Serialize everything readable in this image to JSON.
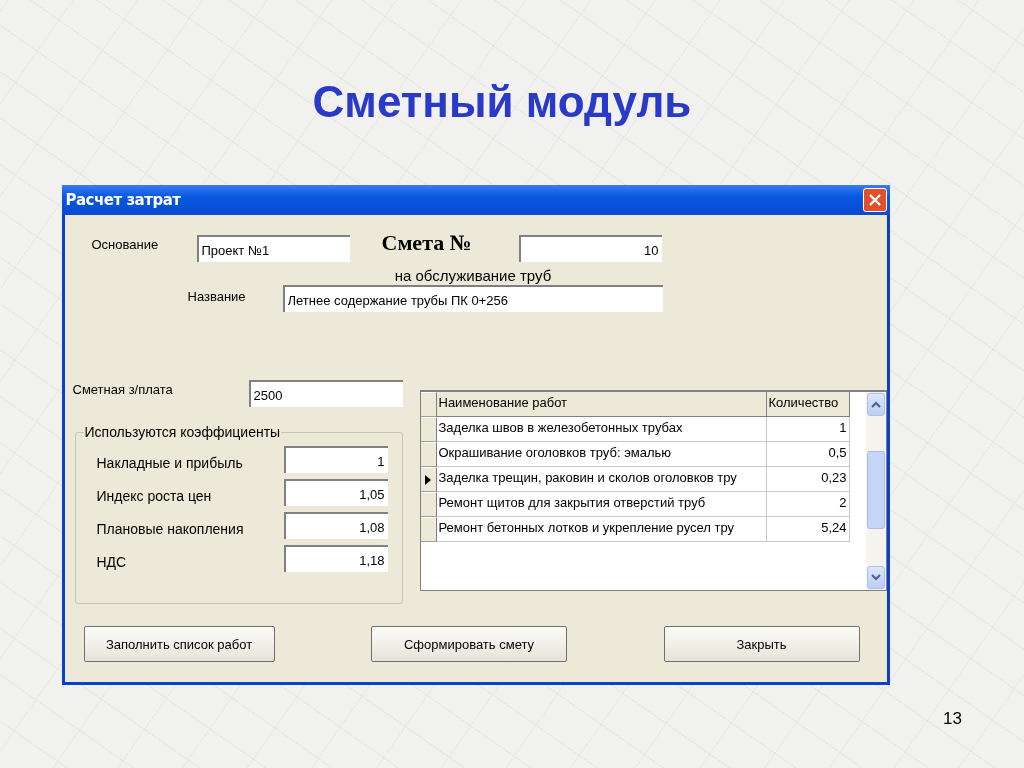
{
  "slide": {
    "title": "Сметный модуль",
    "page_number": "13"
  },
  "window": {
    "title": "Расчет затрат"
  },
  "header": {
    "basis_label": "Основание",
    "basis_value": "Проект №1",
    "estimate_label": "Смета №",
    "estimate_value": "10",
    "subtitle": "на обслуживание труб",
    "name_label": "Название",
    "name_value": "Летнее содержание трубы ПК 0+256"
  },
  "salary": {
    "label": "Сметная з/плата",
    "value": "2500"
  },
  "coefficients": {
    "title": "Используются коэффициенты",
    "items": [
      {
        "label": "Накладные и прибыль",
        "value": "1"
      },
      {
        "label": "Индекс роста цен",
        "value": "1,05"
      },
      {
        "label": "Плановые накопления",
        "value": "1,08"
      },
      {
        "label": "НДС",
        "value": "1,18"
      }
    ]
  },
  "table": {
    "columns": [
      "Наименование работ",
      "Количество"
    ],
    "rows": [
      {
        "cells": [
          "Заделка швов в железобетонных трубах",
          "1"
        ],
        "selected": false
      },
      {
        "cells": [
          "Окрашивание оголовков труб: эмалью",
          "0,5"
        ],
        "selected": false
      },
      {
        "cells": [
          "Заделка трещин, раковин и сколов оголовков тру",
          "0,23"
        ],
        "selected": true
      },
      {
        "cells": [
          "Ремонт щитов для закрытия отверстий труб",
          "2"
        ],
        "selected": false
      },
      {
        "cells": [
          "Ремонт бетонных лотков и укрепление русел тру",
          "5,24"
        ],
        "selected": false
      }
    ]
  },
  "buttons": [
    "Заполнить список работ",
    "Сформировать смету",
    "Закрыть"
  ]
}
